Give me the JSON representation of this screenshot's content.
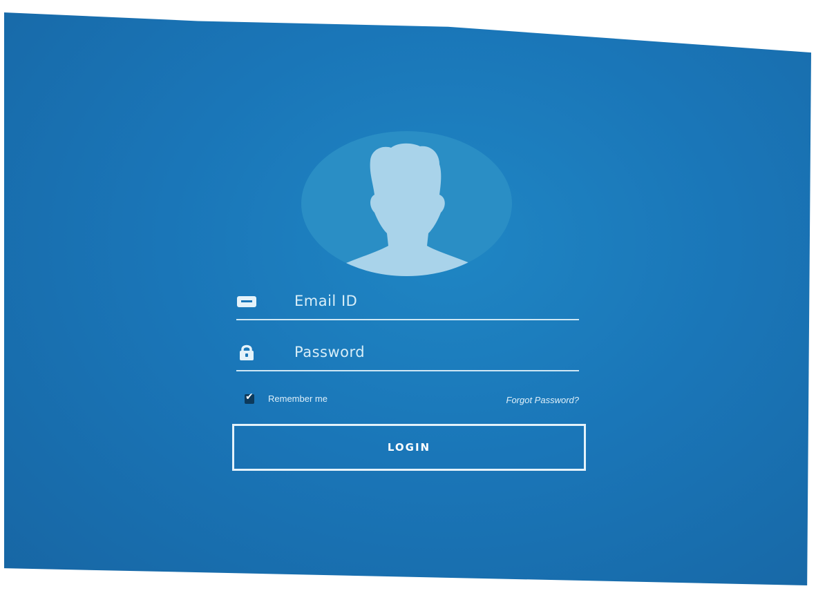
{
  "login": {
    "email_placeholder": "Email ID",
    "password_placeholder": "Password",
    "remember_label": "Remember me",
    "remember_checked": true,
    "forgot_label": "Forgot Password?",
    "login_label": "LOGIN"
  },
  "icons": {
    "avatar": "user-silhouette-icon",
    "email": "envelope-icon",
    "password": "lock-icon",
    "checkbox": "check-icon"
  },
  "colors": {
    "background": "#1a76b8",
    "avatar_circle": "#2a8ec5",
    "silhouette": "#a9d3ea",
    "foreground": "#e4f2fa"
  }
}
